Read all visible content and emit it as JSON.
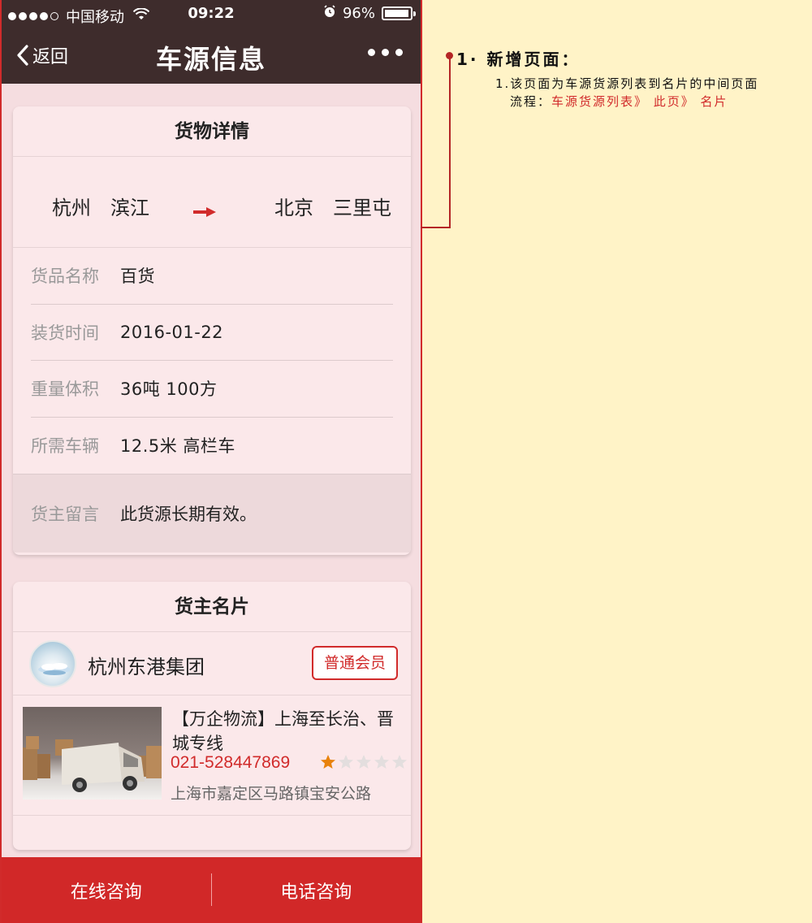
{
  "status_bar": {
    "carrier": "中国移动",
    "time": "09:22",
    "battery": "96%",
    "battery_level": 0.96
  },
  "nav": {
    "back_label": "返回",
    "title": "车源信息"
  },
  "cargo_card": {
    "title": "货物详情",
    "from": "杭州　滨江",
    "to": "北京　三里屯",
    "rows": [
      {
        "label": "货品名称",
        "value": "百货"
      },
      {
        "label": "装货时间",
        "value": "2016-01-22"
      },
      {
        "label": "重量体积",
        "value": "36吨 100方"
      },
      {
        "label": "所需车辆",
        "value": "12.5米 高栏车"
      }
    ],
    "message": {
      "label": "货主留言",
      "value": "此货源长期有效。"
    }
  },
  "owner_card": {
    "title": "货主名片",
    "name": "杭州东港集团",
    "member_label": "普通会员",
    "listing": {
      "headline": "【万企物流】上海至长治、晋城专线",
      "phone": "021-528447869",
      "rating": 1,
      "rating_max": 5,
      "address": "上海市嘉定区马路镇宝安公路"
    }
  },
  "bottom_bar": {
    "online_label": "在线咨询",
    "phone_label": "电话咨询"
  },
  "annotation": {
    "title": "1· 新增页面：",
    "note": "1.该页面为车源货源列表到名片的中间页面",
    "flow_prefix": "流程：",
    "flow_path": "车源货源列表》 此页》 名片"
  },
  "colors": {
    "nav_bg": "#3e2c2c",
    "accent_red": "#d12b2b",
    "page_bg": "#f5dde0",
    "annotation_bg": "#fff3c7",
    "star_active": "#e8820c"
  }
}
